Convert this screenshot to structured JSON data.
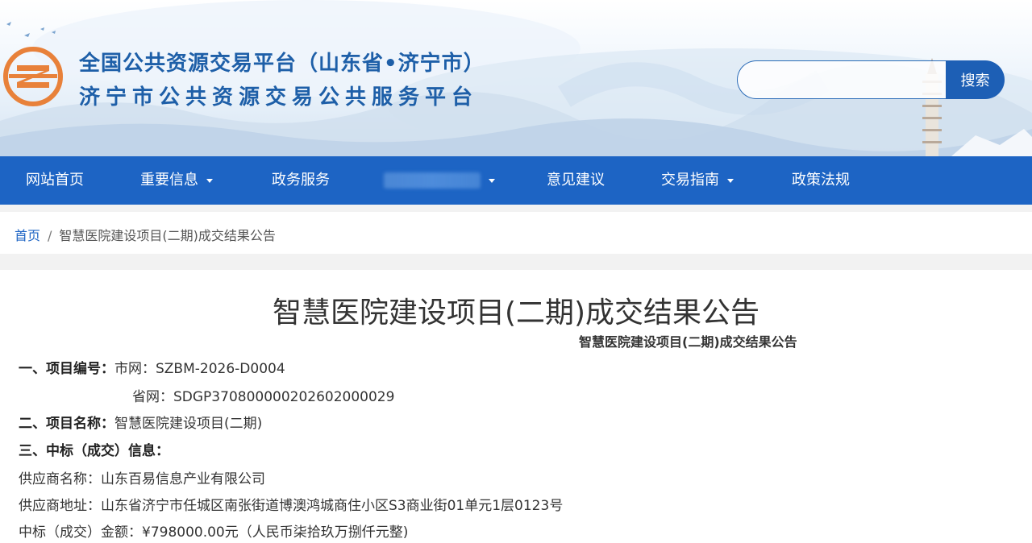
{
  "header": {
    "title_line1": "全国公共资源交易平台（山东省•济宁市）",
    "title_line2": "济宁市公共资源交易公共服务平台",
    "search": {
      "placeholder": "",
      "button_label": "搜索"
    }
  },
  "nav": {
    "items": [
      {
        "label": "网站首页",
        "has_dropdown": false
      },
      {
        "label": "重要信息",
        "has_dropdown": true
      },
      {
        "label": "政务服务",
        "has_dropdown": false
      },
      {
        "label": "",
        "has_dropdown": true
      },
      {
        "label": "意见建议",
        "has_dropdown": false
      },
      {
        "label": "交易指南",
        "has_dropdown": true
      },
      {
        "label": "政策法规",
        "has_dropdown": false
      }
    ]
  },
  "breadcrumb": {
    "home": "首页",
    "separator": "/",
    "current": "智慧医院建设项目(二期)成交结果公告"
  },
  "article": {
    "title": "智慧医院建设项目(二期)成交结果公告",
    "subtitle": "智慧医院建设项目(二期)成交结果公告",
    "project_no_label": "一、项目编号：",
    "project_no_city": "市网：SZBM-2026-D0004",
    "project_no_province": "省网：SDGP370800000202602000029",
    "project_name_label": "二、项目名称：",
    "project_name": "智慧医院建设项目(二期)",
    "award_label": "三、中标（成交）信息：",
    "supplier_name": "供应商名称：山东百易信息产业有限公司",
    "supplier_address": "供应商地址：山东省济宁市任城区南张街道博澳鸿城商住小区S3商业街01单元1层0123号",
    "award_amount": "中标（成交）金额：¥798000.00元（人民币柒拾玖万捌仟元整)"
  },
  "colors": {
    "brand_blue": "#1d64c4",
    "title_blue": "#1e5fa8",
    "logo_orange": "#e8813a"
  }
}
